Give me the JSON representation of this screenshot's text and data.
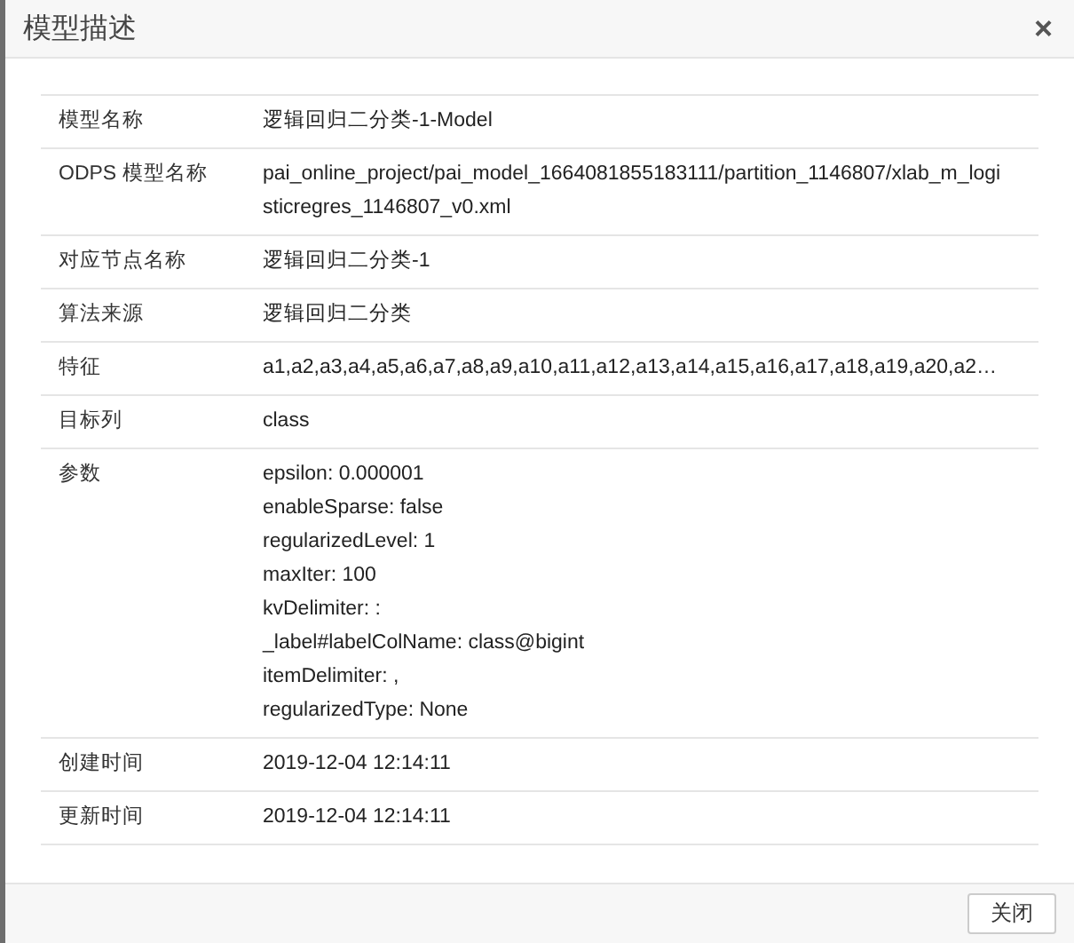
{
  "dialog": {
    "title": "模型描述",
    "close_icon": "×"
  },
  "rows": [
    {
      "kind": "text",
      "label": "模型名称",
      "value": "逻辑回归二分类-1-Model"
    },
    {
      "kind": "text",
      "label": "ODPS 模型名称",
      "value": "pai_online_project/pai_model_1664081855183111/partition_1146807/xlab_m_logisticregres_1146807_v0.xml"
    },
    {
      "kind": "text",
      "label": "对应节点名称",
      "value": "逻辑回归二分类-1"
    },
    {
      "kind": "text",
      "label": "算法来源",
      "value": "逻辑回归二分类"
    },
    {
      "kind": "text",
      "label": "特征",
      "value": "a1,a2,a3,a4,a5,a6,a7,a8,a9,a10,a11,a12,a13,a14,a15,a16,a17,a18,a19,a20,a2…"
    },
    {
      "kind": "text",
      "label": "目标列",
      "value": "class"
    },
    {
      "kind": "list",
      "label": "参数",
      "lines": [
        "epsilon: 0.000001",
        "enableSparse: false",
        "regularizedLevel: 1",
        "maxIter: 100",
        "kvDelimiter: :",
        "_label#labelColName: class@bigint",
        "itemDelimiter: ,",
        "regularizedType: None"
      ]
    },
    {
      "kind": "text",
      "label": "创建时间",
      "value": "2019-12-04 12:14:11"
    },
    {
      "kind": "text",
      "label": "更新时间",
      "value": "2019-12-04 12:14:11"
    }
  ],
  "buttons": [
    "关闭"
  ]
}
